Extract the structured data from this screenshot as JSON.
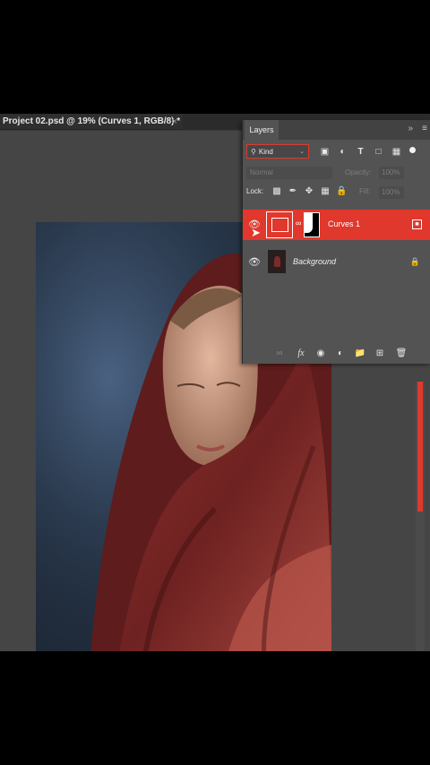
{
  "document": {
    "tab_title": "Project 02.psd @ 19% (Curves 1, RGB/8) *",
    "close_glyph": "×"
  },
  "layers_panel": {
    "tab_label": "Layers",
    "collapse_glyph": "»",
    "menu_glyph": "≡",
    "filter": {
      "kind_label": "Kind",
      "icons": [
        "image-filter-icon",
        "adjustment-filter-icon",
        "type-filter-icon",
        "shape-filter-icon",
        "smart-object-filter-icon"
      ]
    },
    "blend_mode": "Normal",
    "opacity_label": "Opacity:",
    "opacity_value": "100%",
    "lock_label": "Lock:",
    "fill_label": "Fill:",
    "fill_value": "100%",
    "layers": [
      {
        "name": "Curves 1",
        "selected": true,
        "visible": true
      },
      {
        "name": "Background",
        "selected": false,
        "visible": true,
        "locked": true
      }
    ],
    "footer_icons": [
      "link-layers-icon",
      "fx-icon",
      "add-mask-icon",
      "new-adjustment-icon",
      "new-group-icon",
      "new-layer-icon",
      "trash-icon"
    ],
    "fx_label": "fx"
  },
  "colors": {
    "accent": "#e0382c",
    "panel_bg": "#535353",
    "canvas_bg": "#454545"
  }
}
